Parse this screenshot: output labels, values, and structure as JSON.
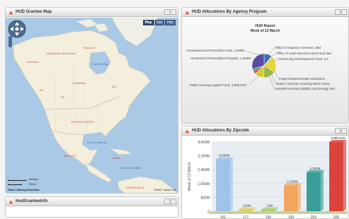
{
  "panels": {
    "map": {
      "title": "HUD Grantee Map"
    },
    "pie": {
      "title": "HUD Allocations By Agency Program"
    },
    "bar": {
      "title": "HUD Allocations By Zipcode"
    },
    "info": {
      "title": "HudGranteeInfo"
    }
  },
  "panel_controls": {
    "minimize": "-",
    "maximize": "▫"
  },
  "map": {
    "type_buttons": [
      "Map",
      "Sat",
      "Hyb"
    ],
    "active_type": "Map",
    "labels": {
      "alaska": "ALASKA",
      "nwt": "Northwest Territories",
      "nunavut": "Nunavut",
      "canada": "CANADA",
      "bc": "BC",
      "sk": "SK",
      "hudson_bay": "Hudson Bay",
      "qc": "QC",
      "united_states": "UNITED STATES",
      "mexico": "MEXICO",
      "gulf": "Gulf of Mexico",
      "cuba": "CUBA",
      "caribbean": "Caribbean Sea",
      "venezuela": "VENEZUELA"
    },
    "scale_km": "1000km",
    "scale_mi": "750mi",
    "attribution": "Data ©Navteq/TeleAtlas",
    "copyright": "©2007 Yahoo! Inc"
  },
  "pie_chart": {
    "report_title": "HUD Report",
    "report_subtitle": "Week of 13 March",
    "labels": [
      "Homelessness Prevention Fund, 1,500M",
      "Office of Inspector General, 15M",
      "Office of Lead Hazard Control and Hea",
      "Community Development Fund, 3,0",
      "Investment Partnerships Program, 2,250M",
      "Project Based Rental Assistance,",
      "Native American Housing Block Grant",
      "Assisted Housing Stability and Energy and",
      "Public Housing Capital Fund, 3,998.97M"
    ],
    "colors": [
      "#3b6fb6",
      "#8fc0e6",
      "#f2a65e",
      "#e8d43c",
      "#9ab54a",
      "#cfcf3a",
      "#d9433b",
      "#2f9c8f",
      "#5a4aa1"
    ]
  },
  "chart_data": {
    "type": "bar",
    "categories": [
      "161",
      "177",
      "190",
      "193",
      "203",
      "205"
    ],
    "values": [
      3000,
      100,
      100,
      1500,
      2250,
      3999
    ],
    "data_labels": [
      "3,000M",
      "100M",
      "10M",
      "1,500M",
      "2,250M",
      "3,999.97M"
    ],
    "ylabel": "Week of 13 March",
    "ytick_labels": [
      "0",
      "800M",
      "1,600M",
      "2,400M",
      "3,200M",
      "4,000M"
    ],
    "ylim": [
      0,
      4000
    ],
    "colors": [
      "#9fc3ea",
      "#dccf5c",
      "#a9cf6e",
      "#f2a65e",
      "#3a9e98",
      "#d9433b"
    ],
    "grid": true
  }
}
